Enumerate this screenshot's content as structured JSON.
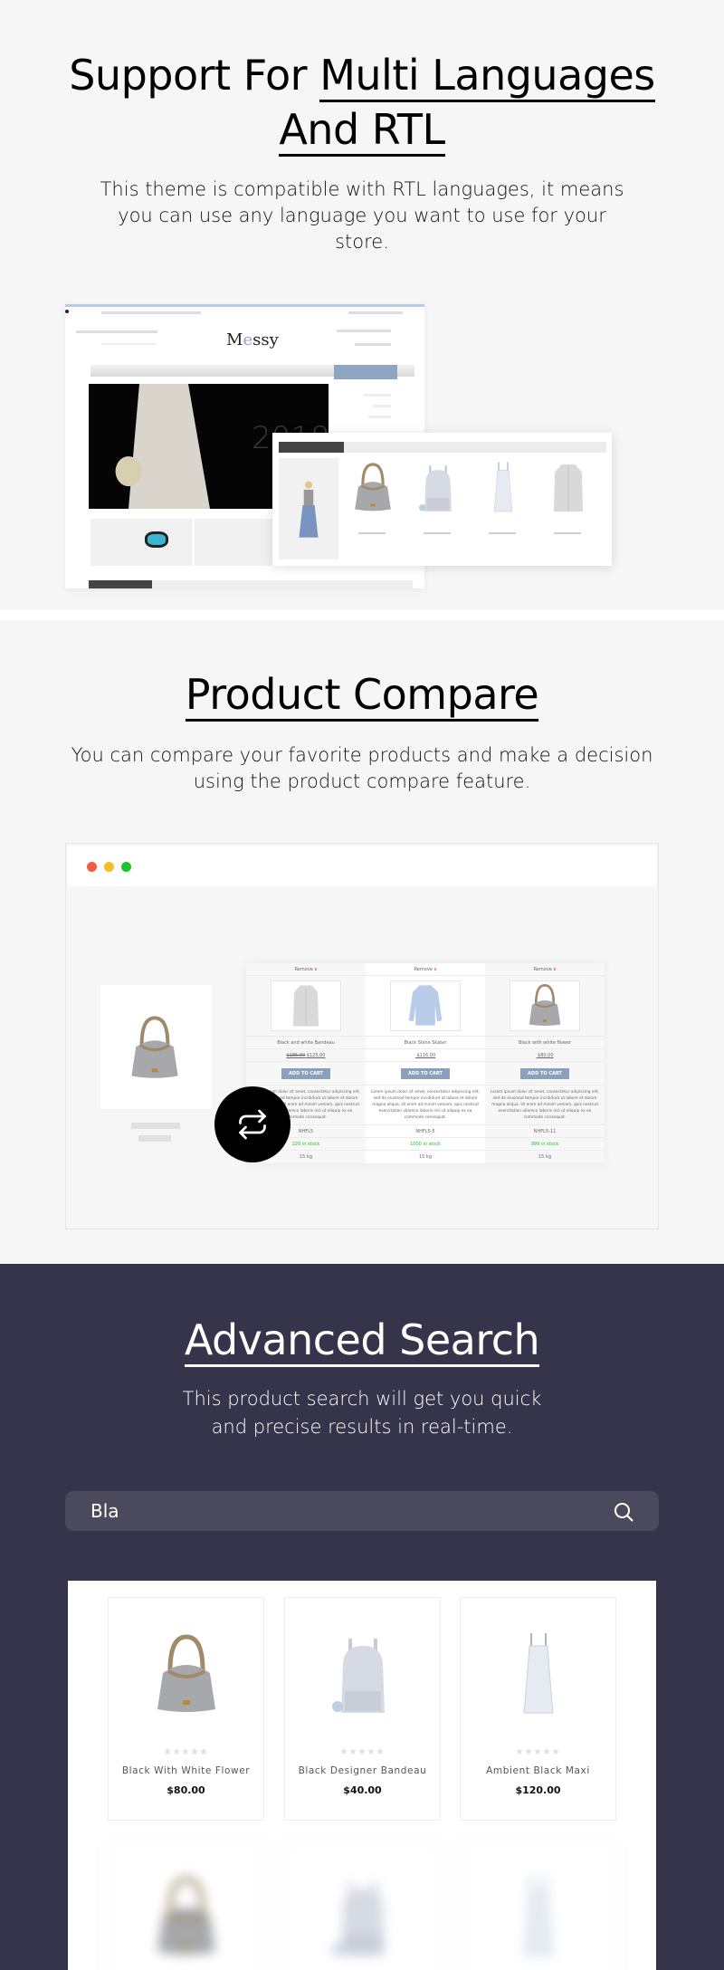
{
  "rtl_section": {
    "title_plain": "Support For ",
    "title_underlined_1": "Multi Languages",
    "title_underlined_2": "And RTL",
    "description": "This theme is compatible with RTL languages, it means you can use any language you want to use for your store.",
    "mockup": {
      "logo_prefix": "M",
      "logo_accent": "e",
      "logo_suffix": "ssy",
      "hero_year": "2018"
    }
  },
  "compare_section": {
    "title": "Product Compare",
    "description": "You can compare your favorite products and make a decision using the product compare feature.",
    "window_dots": [
      "#f25c40",
      "#f9bd1e",
      "#1fc530"
    ],
    "products": [
      {
        "remove": "Remove",
        "name": "Black and white Bandeau",
        "old_price": "$185.00",
        "price": "$125.00",
        "button": "ADD TO CART",
        "description": "Lorem ipsum dolor sit amet, consectetur adipiscing elit, sed do eiusmod tempor incididunt ut labore et dolore magna aliqua. Ut enim ad minim veniam, quis nostrud exercitation ullamco laboris nisi ut aliquip ex ea commodo consequat.",
        "sku": "NHFL5",
        "stock": "220 in stock",
        "weight": "15 kg",
        "image": "coat"
      },
      {
        "remove": "Remove",
        "name": "Black Shine Skater",
        "old_price": "",
        "price": "$116.00",
        "button": "ADD TO CART",
        "description": "Lorem ipsum dolor sit amet, consectetur adipiscing elit, sed do eiusmod tempor incididunt ut labore et dolore magna aliqua. Ut enim ad minim veniam, quis nostrud exercitation ullamco laboris nisi ut aliquip ex ea commodo consequat.",
        "sku": "NHFL5-5",
        "stock": "1000 in stock",
        "weight": "15 kg",
        "image": "shirt"
      },
      {
        "remove": "Remove",
        "name": "Black with white flower",
        "old_price": "",
        "price": "$80.00",
        "button": "ADD TO CART",
        "description": "Lorem ipsum dolor sit amet, consectetur adipiscing elit, sed do eiusmod tempor incididunt ut labore et dolore magna aliqua. Ut enim ad minim veniam, quis nostrud exercitation ullamco laboris nisi ut aliquip ex ea commodo consequat.",
        "sku": "NHFL5-11",
        "stock": "999 in stock",
        "weight": "15 kg",
        "image": "bag"
      }
    ],
    "stock_color": "#2eb82e",
    "remove_color": "#e02020",
    "compare_icon": "repeat-arrows-icon"
  },
  "search_section": {
    "title": "Advanced Search",
    "description_line1": "This product search will get you quick",
    "description_line2": "and precise results in real-time.",
    "search_value": "Bla",
    "search_icon": "search-icon",
    "background": "#35344a",
    "results": [
      {
        "name": "Black With White Flower",
        "price": "$80.00",
        "rating": 0,
        "image": "bag"
      },
      {
        "name": "Black Designer Bandeau",
        "price": "$40.00",
        "rating": 0,
        "image": "backpack"
      },
      {
        "name": "Ambient Black Maxi",
        "price": "$120.00",
        "rating": 0,
        "image": "dress"
      }
    ],
    "stars": "★★★★★"
  }
}
